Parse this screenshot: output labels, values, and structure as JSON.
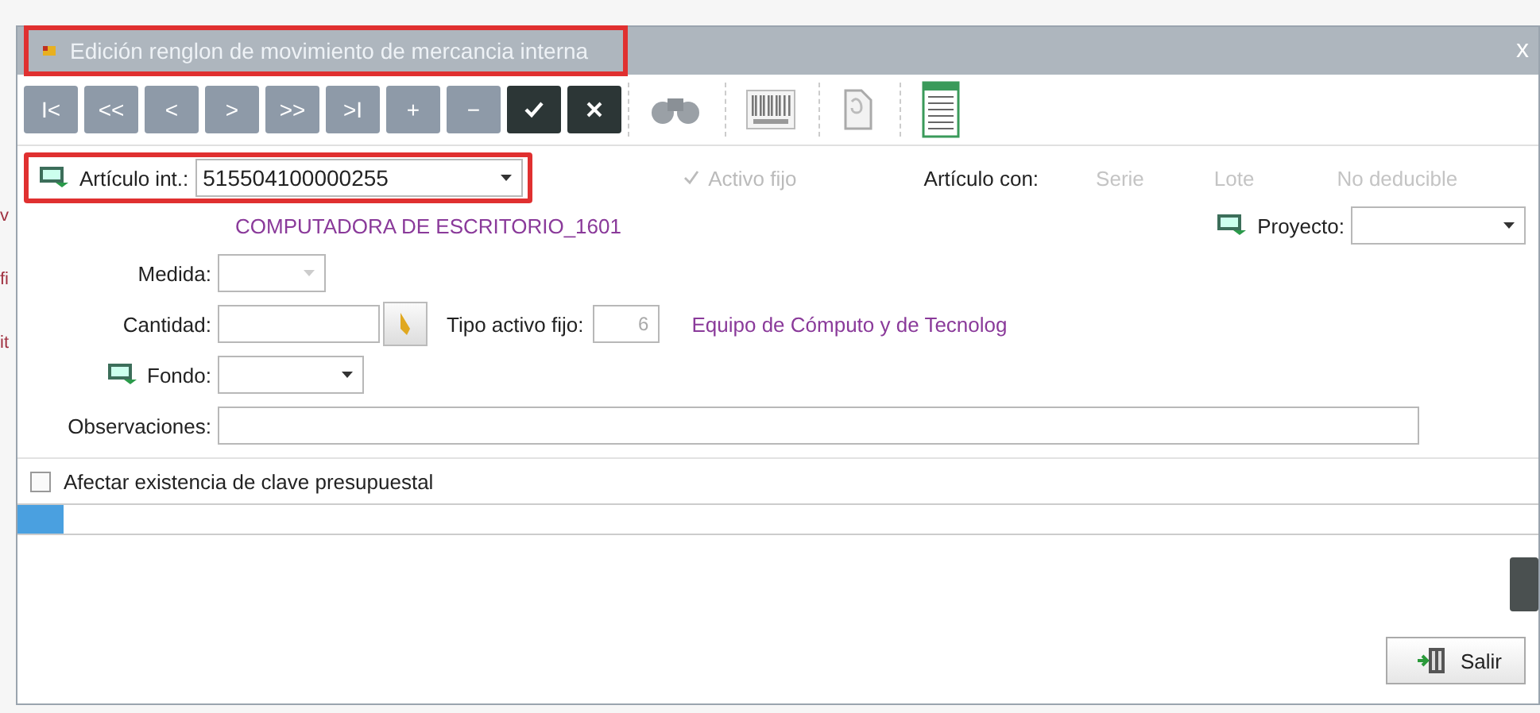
{
  "background_fragments": [
    "v",
    "fi",
    "it"
  ],
  "window": {
    "title": "Edición renglon de movimiento de mercancia interna",
    "title_highlighted": true,
    "close": "x"
  },
  "toolbar": [
    {
      "kind": "nav",
      "label": "I<"
    },
    {
      "kind": "nav",
      "label": "<<"
    },
    {
      "kind": "nav",
      "label": "<"
    },
    {
      "kind": "nav",
      "label": ">"
    },
    {
      "kind": "nav",
      "label": ">>"
    },
    {
      "kind": "nav",
      "label": ">I"
    },
    {
      "kind": "nav",
      "label": "+"
    },
    {
      "kind": "nav",
      "label": "−"
    },
    {
      "kind": "confirm"
    },
    {
      "kind": "cancel"
    },
    {
      "kind": "binoculars"
    },
    {
      "kind": "barcode"
    },
    {
      "kind": "document"
    },
    {
      "kind": "sheet"
    }
  ],
  "form": {
    "articulo": {
      "label": "Artículo int.:",
      "value": "515504100000255",
      "highlighted": true,
      "description": "COMPUTADORA DE ESCRITORIO_1601"
    },
    "activo_fijo": {
      "label": "Activo fijo",
      "checked": true,
      "disabled": true
    },
    "articulo_con": {
      "label": "Artículo con:",
      "options": [
        {
          "label": "Serie",
          "disabled": true
        },
        {
          "label": "Lote",
          "disabled": true
        },
        {
          "label": "No deducible",
          "disabled": true
        }
      ]
    },
    "proyecto": {
      "label": "Proyecto:"
    },
    "medida": {
      "label": "Medida:"
    },
    "cantidad": {
      "label": "Cantidad:"
    },
    "tipo_activo_fijo": {
      "label": "Tipo activo fijo:",
      "value": "6",
      "description": "Equipo de Cómputo y de Tecnolog"
    },
    "fondo": {
      "label": "Fondo:"
    },
    "observaciones": {
      "label": "Observaciones:"
    }
  },
  "afectar": {
    "label": "Afectar existencia de clave presupuestal",
    "checked": false
  },
  "progress": {
    "level": 0.03
  },
  "buttons": [
    {
      "label": "Salir"
    }
  ]
}
